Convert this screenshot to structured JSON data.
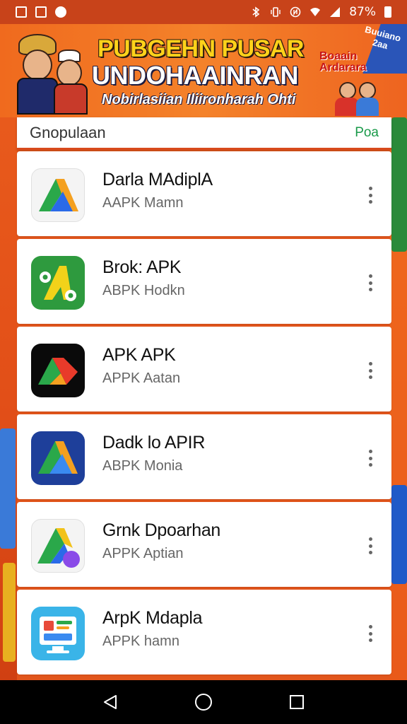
{
  "status_bar": {
    "battery_text": "87%",
    "left_icons": [
      "gallery-icon",
      "image-icon",
      "notification-icon"
    ],
    "right_icons": [
      "bluetooth-icon",
      "vibrate-icon",
      "nfc-icon",
      "wifi-icon",
      "signal-icon",
      "battery-icon"
    ]
  },
  "banner": {
    "title_line1": "PUBGEHN PUSAR",
    "title_line2": "UNDOHAAINRAN",
    "subtitle": "Nobirlasiian Iliironharah Ohti",
    "corner_text": "Buuiano 2aa",
    "right_text_line1": "Boaain",
    "right_text_line2": "Ardarara"
  },
  "search": {
    "text": "Gnopulaan",
    "action_label": "Poa"
  },
  "apps": [
    {
      "name": "Darla MAdiplA",
      "subtitle": "AAPK Mamn",
      "icon": "triangle-a-icon"
    },
    {
      "name": "Brok: APK",
      "subtitle": "ABPK Hodkn",
      "icon": "gear-a-icon"
    },
    {
      "name": "APK APK",
      "subtitle": "APPK Aatan",
      "icon": "dark-a-icon"
    },
    {
      "name": "Dadk lo APIR",
      "subtitle": "ABPK Monia",
      "icon": "blue-a-icon"
    },
    {
      "name": "Grnk Dpoarhan",
      "subtitle": "APPK Aptian",
      "icon": "purple-dot-a-icon"
    },
    {
      "name": "ArpK Mdapla",
      "subtitle": "APPK hamn",
      "icon": "tablet-icon"
    }
  ],
  "nav": {
    "back": "back-icon",
    "home": "home-icon",
    "recents": "recents-icon"
  },
  "colors": {
    "accent": "#e2561c",
    "action_green": "#1a9a4a",
    "banner_yellow": "#ffd21a"
  }
}
